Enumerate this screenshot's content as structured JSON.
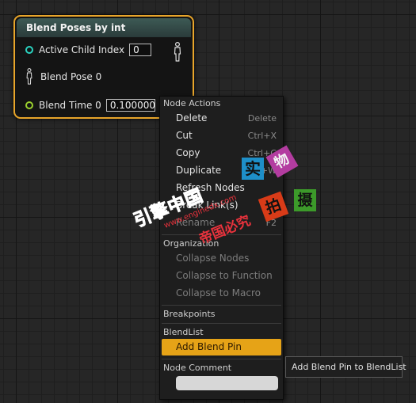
{
  "node": {
    "title": "Blend Poses by int",
    "active_child_label": "Active Child Index",
    "active_child_value": "0",
    "blend_pose_label": "Blend Pose 0",
    "blend_time_label": "Blend Time 0",
    "blend_time_value": "0.100000"
  },
  "menu": {
    "node_actions_header": "Node Actions",
    "items": [
      {
        "label": "Delete",
        "shortcut": "Delete"
      },
      {
        "label": "Cut",
        "shortcut": "Ctrl+X"
      },
      {
        "label": "Copy",
        "shortcut": "Ctrl+C"
      },
      {
        "label": "Duplicate",
        "shortcut": "Ctrl+W"
      },
      {
        "label": "Refresh Nodes",
        "shortcut": ""
      },
      {
        "label": "Break Link(s)",
        "shortcut": ""
      },
      {
        "label": "Rename",
        "shortcut": "F2"
      }
    ],
    "organization_header": "Organization",
    "organization_items": [
      "Collapse Nodes",
      "Collapse to Function",
      "Collapse to Macro"
    ],
    "breakpoints_header": "Breakpoints",
    "blendlist_header": "BlendList",
    "add_blend_pin": "Add Blend Pin",
    "node_comment_header": "Node Comment",
    "node_comment_value": ""
  },
  "tooltip": {
    "text": "Add Blend Pin to BlendList"
  },
  "watermark": {
    "tile_1": "实",
    "tile_2": "物",
    "tile_3": "拍",
    "tile_4": "摄",
    "line_1": "引擎中国",
    "line_2": "www.enginedx.com",
    "line_3": "帝国必究"
  },
  "colors": {
    "node_border": "#e8a52a",
    "node_header": "#3d5a55",
    "pin_exec_teal": "#2ad3c0",
    "pin_float_green": "#9bd12e",
    "menu_highlight": "#e6a317",
    "background": "#262626"
  }
}
